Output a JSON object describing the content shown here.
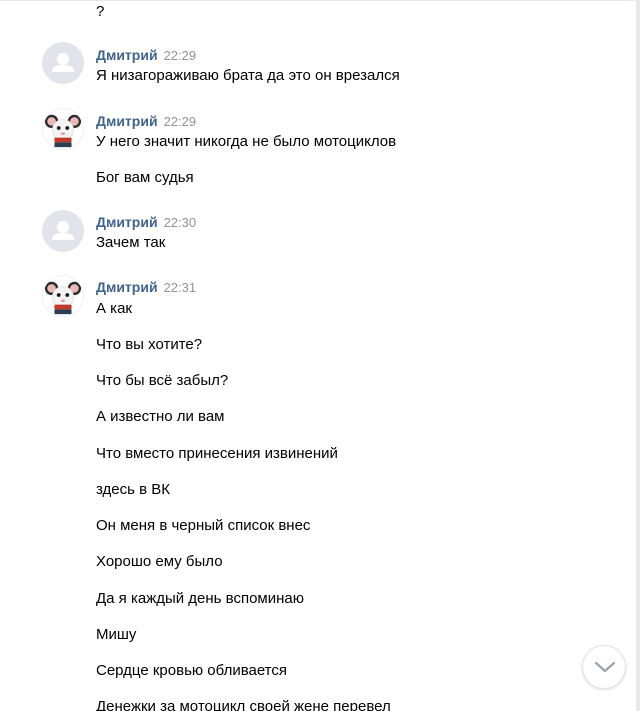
{
  "top_fragment": "?",
  "messages": [
    {
      "author": "Дмитрий",
      "time": "22:29",
      "avatar": "default-user-icon",
      "lines": [
        "Я низагораживаю брата да это он врезался"
      ]
    },
    {
      "author": "Дмитрий",
      "time": "22:29",
      "avatar": "rat-photo",
      "lines": [
        "У него значит никогда не было мотоциклов",
        "Бог вам судья"
      ]
    },
    {
      "author": "Дмитрий",
      "time": "22:30",
      "avatar": "default-user-icon",
      "lines": [
        "Зачем так"
      ]
    },
    {
      "author": "Дмитрий",
      "time": "22:31",
      "avatar": "rat-photo",
      "lines": [
        "А как",
        "Что вы хотите?",
        "Что бы всё забыл?",
        "А известно ли вам",
        "Что вместо принесения извинений",
        "здесь в ВК",
        "Он меня в черный список внес",
        "Хорошо ему было",
        "Да я каждый день вспоминаю",
        "Мишу",
        "Сердце кровью обливается",
        "Денежки за мотоцикл своей жене перевел"
      ]
    }
  ],
  "scroll_down_button": {
    "icon": "chevron-down-icon"
  },
  "colors": {
    "author": "#42648b",
    "time": "#939393",
    "text": "#000000",
    "default_avatar_bg": "#e1e5eb",
    "chevron": "#99a2ad"
  }
}
